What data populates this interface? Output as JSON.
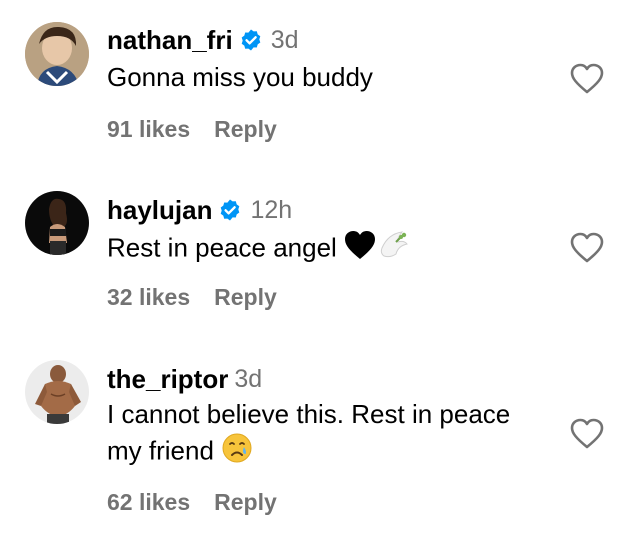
{
  "comments": [
    {
      "username": "nathan_fri",
      "verified": true,
      "time": "3d",
      "text": "Gonna miss you buddy",
      "likes": "91 likes",
      "reply": "Reply",
      "avatar_icon": "avatar-photo"
    },
    {
      "username": "haylujan",
      "verified": true,
      "time": "12h",
      "text": "Rest in peace angel",
      "emoji": "🖤🕊",
      "likes": "32 likes",
      "reply": "Reply",
      "avatar_icon": "avatar-photo"
    },
    {
      "username": "the_riptor",
      "verified": false,
      "time": "3d",
      "text_line1": "I cannot believe this. Rest in peace",
      "text_line2": "my friend",
      "emoji": "😢",
      "likes": "62 likes",
      "reply": "Reply",
      "avatar_icon": "avatar-photo"
    }
  ],
  "colors": {
    "verified_blue": "#0095f6",
    "muted_text": "#737373",
    "heart_stroke": "#737373"
  },
  "icons": [
    "verified-badge-icon",
    "heart-outline-icon"
  ]
}
